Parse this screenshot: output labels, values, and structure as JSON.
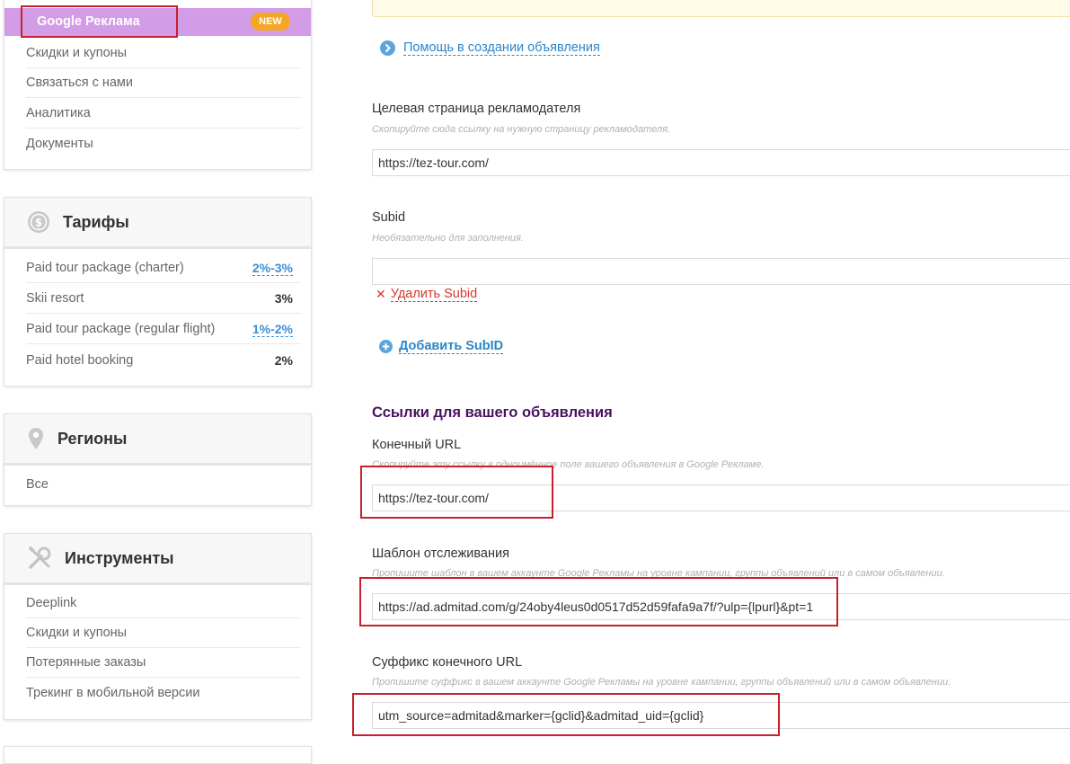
{
  "sidebar": {
    "menu": {
      "active_item": "Google Реклама",
      "active_badge": "NEW",
      "items": [
        "Скидки и купоны",
        "Связаться с нами",
        "Аналитика",
        "Документы"
      ]
    },
    "tariffs": {
      "title": "Тарифы",
      "rows": [
        {
          "name": "Paid tour package (charter)",
          "rate": "2%-3%",
          "linked": true
        },
        {
          "name": "Skii resort",
          "rate": "3%",
          "linked": false
        },
        {
          "name": "Paid tour package (regular flight)",
          "rate": "1%-2%",
          "linked": true
        },
        {
          "name": "Paid hotel booking",
          "rate": "2%",
          "linked": false
        }
      ]
    },
    "regions": {
      "title": "Регионы",
      "items": [
        "Все"
      ]
    },
    "tools": {
      "title": "Инструменты",
      "items": [
        "Deeplink",
        "Скидки и купоны",
        "Потерянные заказы",
        "Трекинг в мобильной версии"
      ]
    }
  },
  "main": {
    "help_link": "Помощь в создании объявления",
    "landing": {
      "label": "Целевая страница рекламодателя",
      "hint": "Скопируйте сюда ссылку на нужную страницу рекламодателя.",
      "value": "https://tez-tour.com/"
    },
    "subid": {
      "label": "Subid",
      "hint": "Необязательно для заполнения.",
      "value": "",
      "remove_label": "Удалить Subid",
      "add_label": "Добавить SubID"
    },
    "links_section_title": "Ссылки для вашего объявления",
    "final_url": {
      "label": "Конечный URL",
      "hint": "Скопируйте эту ссылку в одноимённое поле вашего объявления в Google Рекламе.",
      "value": "https://tez-tour.com/"
    },
    "tracking_template": {
      "label": "Шаблон отслеживания",
      "hint": "Пропишите шаблон в вашем аккаунте Google Рекламы на уровне кампании, группы объявлений или в самом объявлении.",
      "value": "https://ad.admitad.com/g/24oby4leus0d0517d52d59fafa9a7f/?ulp={lpurl}&pt=1"
    },
    "final_url_suffix": {
      "label": "Суффикс конечного URL",
      "hint": "Пропишите суффикс в вашем аккаунте Google Рекламы на уровне кампании, группы объявлений или в самом объявлении.",
      "value": "utm_source=admitad&marker={gclid}&admitad_uid={gclid}"
    }
  },
  "colors": {
    "active_menu_bg": "#d39ce6",
    "badge": "#f5a623",
    "link_blue": "#2c86c9",
    "section_title": "#4a1060",
    "annotation_red": "#c8202a",
    "remove_red": "#d9362b"
  }
}
